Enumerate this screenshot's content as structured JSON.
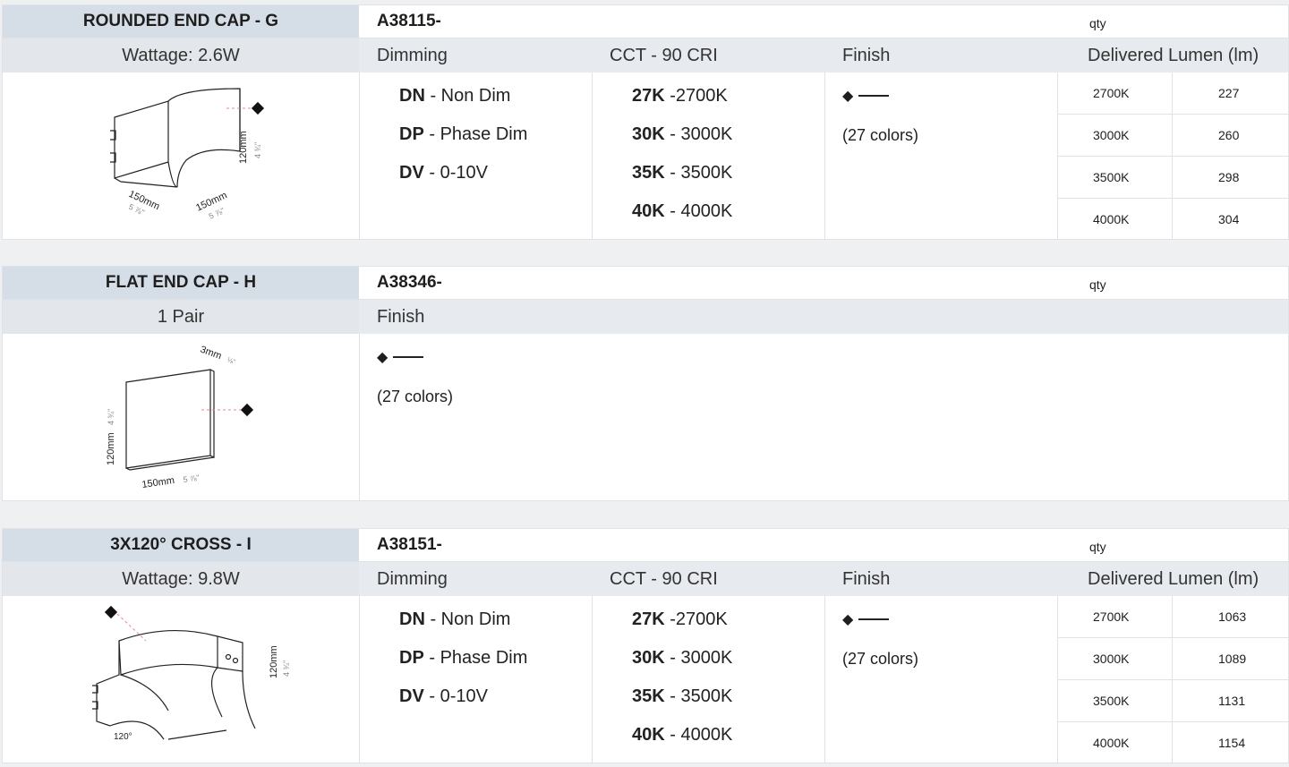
{
  "sections": [
    {
      "name": "ROUNDED END CAP - G",
      "code": "A38115-",
      "qty_label": "qty",
      "sub_left": "Wattage: 2.6W",
      "dimming_header": "Dimming",
      "cct_header": "CCT - 90 CRI",
      "finish_header": "Finish",
      "lumen_header": "Delivered Lumen (lm)",
      "dimming": [
        {
          "code": "DN",
          "label": " - Non Dim"
        },
        {
          "code": "DP",
          "label": " - Phase Dim"
        },
        {
          "code": "DV",
          "label": " - 0-10V"
        }
      ],
      "cct": [
        {
          "code": "27K",
          "label": " -2700K"
        },
        {
          "code": "30K",
          "label": " - 3000K"
        },
        {
          "code": "35K",
          "label": " - 3500K"
        },
        {
          "code": "40K",
          "label": " - 4000K"
        }
      ],
      "finish_colors": "(27 colors)",
      "lumens": [
        {
          "cct": "2700K",
          "lm": "227"
        },
        {
          "cct": "3000K",
          "lm": "260"
        },
        {
          "cct": "3500K",
          "lm": "298"
        },
        {
          "cct": "4000K",
          "lm": "304"
        }
      ],
      "drawing": {
        "height": "120mm",
        "height_in": "4 ¾\"",
        "w1": "150mm",
        "w1_in": "5 ⅞\"",
        "w2": "150mm",
        "w2_in": "5 ⅞\""
      }
    },
    {
      "name": "FLAT END CAP - H",
      "code": "A38346-",
      "qty_label": "qty",
      "sub_left": "1 Pair",
      "finish_header": "Finish",
      "finish_colors": "(27 colors)",
      "drawing": {
        "thick": "3mm",
        "thick_in": "⅛\"",
        "height": "120mm",
        "height_in": "4 ¾\"",
        "width": "150mm",
        "width_in": "5 ⅞\""
      }
    },
    {
      "name": "3X120° CROSS - I",
      "code": "A38151-",
      "qty_label": "qty",
      "sub_left": "Wattage: 9.8W",
      "dimming_header": "Dimming",
      "cct_header": "CCT - 90 CRI",
      "finish_header": "Finish",
      "lumen_header": "Delivered Lumen (lm)",
      "dimming": [
        {
          "code": "DN",
          "label": " - Non Dim"
        },
        {
          "code": "DP",
          "label": " - Phase Dim"
        },
        {
          "code": "DV",
          "label": " - 0-10V"
        }
      ],
      "cct": [
        {
          "code": "27K",
          "label": " -2700K"
        },
        {
          "code": "30K",
          "label": " - 3000K"
        },
        {
          "code": "35K",
          "label": " - 3500K"
        },
        {
          "code": "40K",
          "label": " - 4000K"
        }
      ],
      "finish_colors": "(27 colors)",
      "lumens": [
        {
          "cct": "2700K",
          "lm": "1063"
        },
        {
          "cct": "3000K",
          "lm": "1089"
        },
        {
          "cct": "3500K",
          "lm": "1131"
        },
        {
          "cct": "4000K",
          "lm": "1154"
        }
      ],
      "drawing": {
        "angle": "120°",
        "height": "120mm",
        "height_in": "4 ¾\""
      }
    }
  ]
}
